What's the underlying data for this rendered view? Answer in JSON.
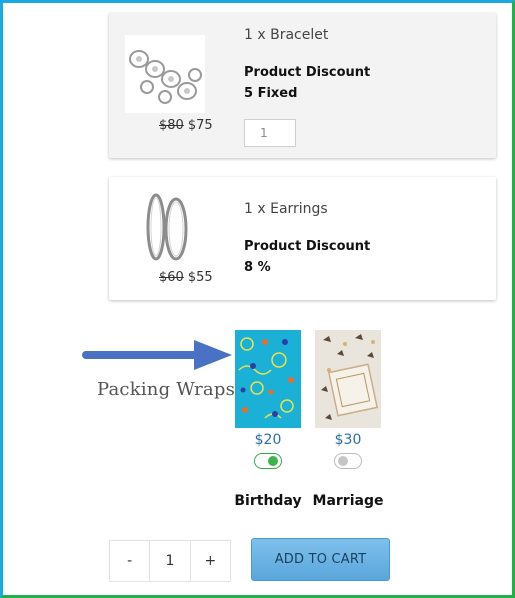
{
  "cart_items": [
    {
      "title": "1 x Bracelet",
      "old_price": "$80",
      "new_price": "$75",
      "discount_label": "Product Discount",
      "discount_value": "5 Fixed",
      "quantity": "1",
      "image_icon": "bracelet-image"
    },
    {
      "title": "1 x Earrings",
      "old_price": "$60",
      "new_price": "$55",
      "discount_label": "Product Discount",
      "discount_value": "8 %",
      "image_icon": "earrings-image"
    }
  ],
  "packing": {
    "label": "Packing Wraps",
    "arrow_icon": "right-arrow-icon",
    "options": [
      {
        "name": "Birthday",
        "price": "$20",
        "selected": true,
        "color": "#1bb0d6"
      },
      {
        "name": "Marriage",
        "price": "$30",
        "selected": false,
        "color": "#e9e4dc"
      }
    ]
  },
  "footer": {
    "decrement_label": "-",
    "quantity": "1",
    "increment_label": "+",
    "add_to_cart_label": "ADD TO CART"
  },
  "colors": {
    "accent": "#5aa6dc",
    "price_blue": "#2f6ea8",
    "toggle_on": "#3cb44a",
    "frame_left": "#1aa9e1",
    "frame_right": "#21b14b"
  }
}
